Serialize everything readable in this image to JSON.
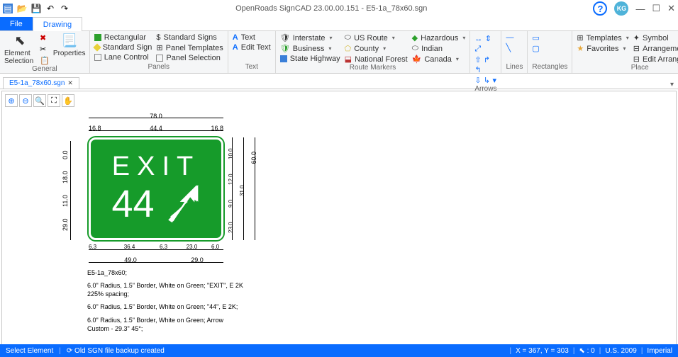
{
  "app": {
    "title": "OpenRoads SignCAD 23.00.00.151 - E5-1a_78x60.sgn",
    "user_initials": "KG"
  },
  "tabs": {
    "file": "File",
    "drawing": "Drawing"
  },
  "ribbon": {
    "general": {
      "label": "General",
      "element_selection": "Element Selection",
      "properties": "Properties"
    },
    "panels": {
      "label": "Panels",
      "rectangular": "Rectangular",
      "standard_sign": "Standard Sign",
      "lane_control": "Lane Control",
      "standard_signs": "Standard Signs",
      "panel_templates": "Panel Templates",
      "panel_selection": "Panel Selection"
    },
    "text": {
      "label": "Text",
      "text": "Text",
      "edit_text": "Edit Text"
    },
    "route": {
      "label": "Route Markers",
      "interstate": "Interstate",
      "business": "Business",
      "state_highway": "State Highway",
      "us_route": "US Route",
      "county": "County",
      "national_forest": "National Forest",
      "hazardous": "Hazardous",
      "indian": "Indian",
      "canada": "Canada"
    },
    "arrows": "Arrows",
    "lines": "Lines",
    "rectangles": "Rectangles",
    "place": {
      "label": "Place",
      "templates": "Templates",
      "favorites": "Favorites",
      "symbol": "Symbol",
      "arrangement": "Arrangement",
      "edit_arrangement": "Edit Arrangement"
    }
  },
  "doctab": "E5-1a_78x60.sgn",
  "sign": {
    "exit": "EXIT",
    "number": "44"
  },
  "dims": {
    "top_overall": "78.0",
    "top_row": [
      "16.8",
      "44.4",
      "16.8"
    ],
    "bot_row1": [
      "6.3",
      "36.4",
      "6.3",
      "23.0",
      "6.0"
    ],
    "bot_row2": [
      "49.0",
      "29.0"
    ],
    "left": [
      "11.0",
      "18.0",
      "0.0",
      "29.0"
    ],
    "right_col1": [
      "10.0",
      "12.0",
      "9.0",
      "23.0"
    ],
    "right_col2": [
      "31.0"
    ],
    "right_overall": "60.0"
  },
  "notes": {
    "n1": "E5-1a_78x60;",
    "n2": "6.0\" Radius, 1.5\" Border, White on Green; \"EXIT\",  E 2K 225% spacing;",
    "n3": "6.0\" Radius, 1.5\" Border, White on Green; \"44\",  E 2K;",
    "n4": "6.0\" Radius, 1.5\" Border, White on Green; Arrow Custom - 29.3\" 45°;"
  },
  "status": {
    "left1": "Select Element",
    "left2": "Old SGN file backup created",
    "coords": "X = 367, Y = 303",
    "snap": ": 0",
    "std": "U.S. 2009",
    "units": "Imperial"
  }
}
